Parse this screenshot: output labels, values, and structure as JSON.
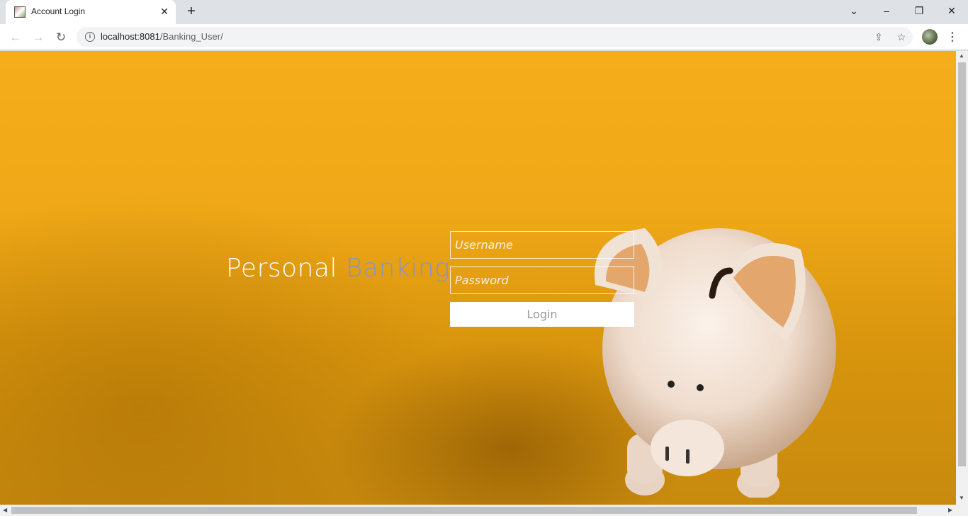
{
  "browser": {
    "tab_title": "Account Login",
    "url_host": "localhost:8081",
    "url_path": "/Banking_User/"
  },
  "page": {
    "brand_part1": "Personal",
    "brand_part2": "Banking",
    "username_placeholder": "Username",
    "password_placeholder": "Password",
    "login_label": "Login"
  },
  "colors": {
    "background_orange": "#f6ad1c",
    "brand_accent": "#8b93c8"
  }
}
